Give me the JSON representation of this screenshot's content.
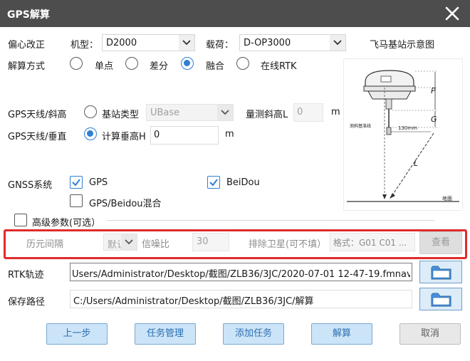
{
  "window": {
    "title": "GPS解算"
  },
  "eccentric": {
    "label": "偏心改正",
    "model_label": "机型：",
    "model_value": "D2000",
    "payload_label": "载荷：",
    "payload_value": "D-OP3000",
    "diagram_title": "飞马基站示意图"
  },
  "solve_mode": {
    "label": "解算方式",
    "options": [
      "单点",
      "差分",
      "融合",
      "在线RTK"
    ],
    "selected": "融合"
  },
  "antenna": {
    "slant_label": "GPS天线/斜高",
    "vertical_label": "GPS天线/垂直",
    "base_type_label": "基站类型",
    "base_type_value": "UBase",
    "measured_slant_label": "量测斜高L",
    "measured_slant_value": "0",
    "measured_slant_unit": "m",
    "calc_vertical_label": "计算垂高H",
    "calc_vertical_value": "0",
    "calc_vertical_unit": "m",
    "selected": "计算垂高H"
  },
  "diagram": {
    "p": "P",
    "g": "G",
    "l": "L",
    "measure": "130mm",
    "mark": "测斜基准线",
    "ground": "地面"
  },
  "gnss": {
    "label": "GNSS系统",
    "gps": "GPS",
    "gps_checked": true,
    "beidou": "BeiDou",
    "beidou_checked": true,
    "mixed": "GPS/Beidou混合",
    "mixed_checked": false
  },
  "advanced": {
    "label": "高级参数(可选）",
    "checked": false,
    "epoch_label": "历元间隔",
    "epoch_value": "默认",
    "snr_label": "信噪比",
    "snr_value": "30",
    "exclude_label": "排除卫星(可不填）",
    "exclude_placeholder": "格式：G01 C01 ...",
    "view_button": "查看"
  },
  "rtk": {
    "label": "RTK轨迹",
    "path": "Users/Administrator/Desktop/截图/ZLB36/3JC/2020-07-01 12-47-19.fmnav"
  },
  "save": {
    "label": "保存路径",
    "path": "C:/Users/Administrator/Desktop/截图/ZLB36/3JC/解算"
  },
  "buttons": {
    "prev": "上一步",
    "task_manage": "任务管理",
    "add_task": "添加任务",
    "solve": "解算",
    "cancel": "取消"
  },
  "colors": {
    "titlebar": "#4d4d4d",
    "accent": "#2f7fd6",
    "highlight": "#e12b2b",
    "button_bg": "#cce4f7"
  }
}
